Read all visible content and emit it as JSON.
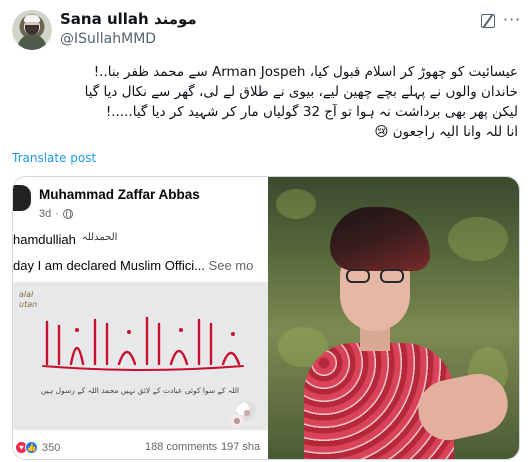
{
  "author": {
    "display_name": "Sana ullah مومند",
    "handle": "@ISullahMMD"
  },
  "tweet": {
    "lines": [
      "عیسائیت کو چھوڑ کر اسلام قبول کیا، Arman Jospeh سے محمد ظفر بنا..!",
      "خاندان والوں نے پہلے بچے چھین لیے، بیوی نے طلاق لے لی، گھر سے نکال دیا گیا",
      "لیکن پھر بھی برداشت نہ ہوا تو آج 32 گولیاں مار کر شہید کر دیا گیا.....!",
      "انا للہ وانا الیہ راجعون 😢"
    ],
    "translate_label": "Translate post"
  },
  "facebook_post": {
    "name": "Muhammad Zaffar Abbas",
    "age": "3d",
    "dot": "·",
    "line1_prefix": "hamdulliah",
    "line1_arabic": "الحمدللہ",
    "line2": "day I am declared Muslim Offici...",
    "see_more": "See mo",
    "watermark": "alal\nutan",
    "banner_caption": "اللہ کے سوا کوئی عبادت کے لائق نہیں محمد اللہ کے رسول ہیں",
    "reaction_count": "350",
    "comments": "188 comments",
    "shares": "197 sha"
  },
  "icons": {
    "grok": "grok-icon",
    "more": "more-icon",
    "globe": "globe-icon"
  },
  "colors": {
    "link": "#1d9bf0",
    "muted": "#536471",
    "border": "#cfd9de",
    "calligraphy": "#c8102e"
  }
}
